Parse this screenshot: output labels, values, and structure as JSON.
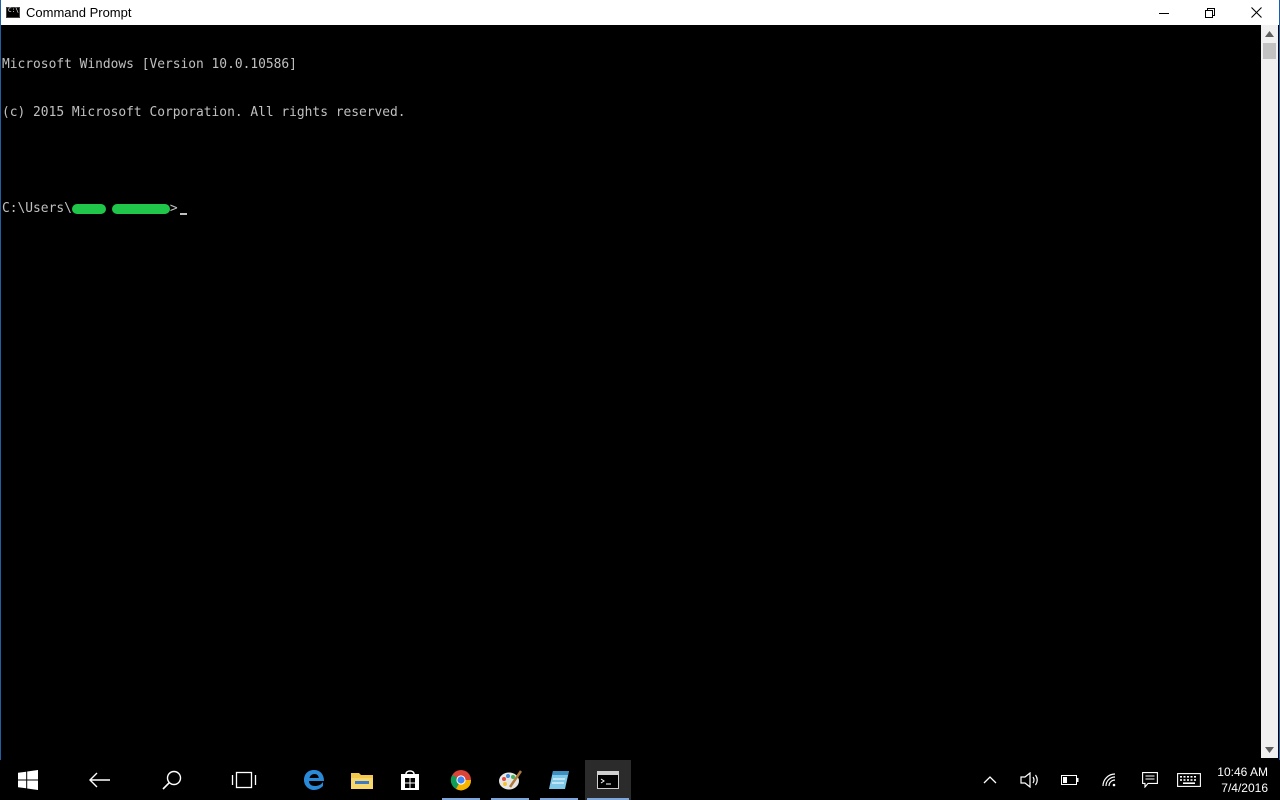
{
  "window": {
    "title": "Command Prompt",
    "icon": "cmd-icon",
    "controls": {
      "minimize": "minimize-icon",
      "restore": "restore-icon",
      "close": "close-icon"
    }
  },
  "console": {
    "lines": [
      "Microsoft Windows [Version 10.0.10586]",
      "(c) 2015 Microsoft Corporation. All rights reserved.",
      "",
      "C:\\Users\\"
    ],
    "prompt_suffix": ">",
    "colors": {
      "background": "#000000",
      "text": "#c0c0c0",
      "redaction": "#1fc64a"
    }
  },
  "taskbar": {
    "items": [
      {
        "name": "start-button",
        "icon": "windows-logo-icon"
      },
      {
        "name": "back-button",
        "icon": "back-arrow-icon"
      },
      {
        "name": "search-button",
        "icon": "search-icon"
      },
      {
        "name": "task-view-button",
        "icon": "task-view-icon"
      },
      {
        "name": "edge-button",
        "icon": "edge-icon"
      },
      {
        "name": "file-explorer-button",
        "icon": "folder-icon"
      },
      {
        "name": "store-button",
        "icon": "store-icon"
      },
      {
        "name": "chrome-button",
        "icon": "chrome-icon"
      },
      {
        "name": "paint-button",
        "icon": "paint-icon"
      },
      {
        "name": "notepad-button",
        "icon": "notepad-icon"
      },
      {
        "name": "cmd-button",
        "icon": "cmd-icon"
      }
    ],
    "tray": [
      "chevron-up-icon",
      "volume-icon",
      "battery-icon",
      "wifi-icon",
      "action-center-icon",
      "keyboard-icon"
    ],
    "clock": {
      "time": "10:46 AM",
      "date": "7/4/2016"
    }
  }
}
